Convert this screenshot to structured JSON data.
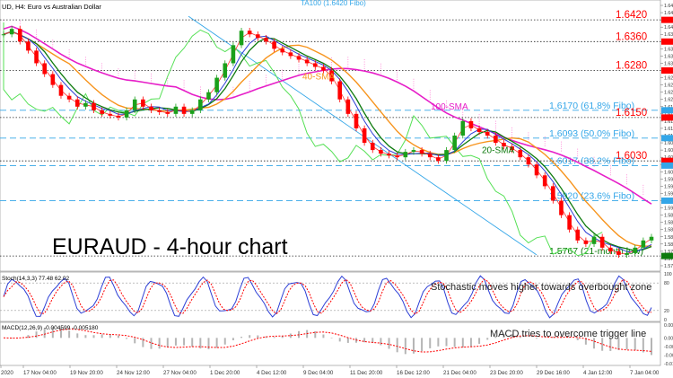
{
  "header": {
    "symbol_text": "UD, H4:  Euro vs Australian Dollar",
    "top_label": "TA100 (1.6420 Fibo)"
  },
  "chart_data": {
    "type": "candlestick",
    "title": "EURAUD - 4-hour chart",
    "x_labels": [
      "2020",
      "17 Nov 04:00",
      "19 Nov 20:00",
      "24 Nov 12:00",
      "27 Nov 04:00",
      "1 Dec 20:00",
      "4 Dec 12:00",
      "9 Dec 04:00",
      "11 Dec 20:00",
      "16 Dec 12:00",
      "21 Dec 04:00",
      "23 Dec 20:00",
      "29 Dec 16:00",
      "4 Jan 12:00",
      "7 Jan 04:00"
    ],
    "price_range": [
      1.573,
      1.647
    ],
    "levels": [
      {
        "price": 1.642,
        "label": "1.6420",
        "color": "#ff0000",
        "style": "dot"
      },
      {
        "price": 1.636,
        "label": "1.6360",
        "color": "#ff0000",
        "style": "dot"
      },
      {
        "price": 1.628,
        "label": "1.6280",
        "color": "#ff0000",
        "style": "dot"
      },
      {
        "price": 1.617,
        "label": "1.6170 (61.8% Fibo)",
        "color": "#33a6e8",
        "style": "dash"
      },
      {
        "price": 1.615,
        "label": "1.6150",
        "color": "#ff0000",
        "style": "dot"
      },
      {
        "price": 1.6093,
        "label": "1.6093 (50.0% Fibo)",
        "color": "#33a6e8",
        "style": "dash"
      },
      {
        "price": 1.603,
        "label": "1.6030",
        "color": "#ff0000",
        "style": "dot"
      },
      {
        "price": 1.6017,
        "label": "1.6017 (38.2% Fibo)",
        "color": "#33a6e8",
        "style": "dash"
      },
      {
        "price": 1.592,
        "label": "1.5920 (23.6% Fibo)",
        "color": "#33a6e8",
        "style": "dash"
      },
      {
        "price": 1.5767,
        "label": "1.5767 (21-month low)",
        "color": "#0d7a0d",
        "style": "dot"
      }
    ],
    "sma_labels": [
      {
        "text": "40-SMA",
        "color": "#f7941d"
      },
      {
        "text": "100-SMA",
        "color": "#e61ec8"
      },
      {
        "text": "20-SMA",
        "color": "#0d7a0d"
      }
    ],
    "closes": [
      1.638,
      1.6395,
      1.636,
      1.6335,
      1.63,
      1.627,
      1.624,
      1.621,
      1.62,
      1.618,
      1.619,
      1.617,
      1.616,
      1.6155,
      1.615,
      1.617,
      1.62,
      1.618,
      1.617,
      1.6165,
      1.616,
      1.618,
      1.616,
      1.617,
      1.62,
      1.622,
      1.626,
      1.63,
      1.635,
      1.639,
      1.638,
      1.637,
      1.636,
      1.634,
      1.633,
      1.632,
      1.631,
      1.63,
      1.629,
      1.628,
      1.625,
      1.62,
      1.616,
      1.612,
      1.608,
      1.606,
      1.605,
      1.6045,
      1.604,
      1.6055,
      1.606,
      1.605,
      1.604,
      1.603,
      1.606,
      1.61,
      1.614,
      1.612,
      1.611,
      1.61,
      1.608,
      1.607,
      1.606,
      1.604,
      1.602,
      1.599,
      1.596,
      1.592,
      1.588,
      1.584,
      1.581,
      1.58,
      1.582,
      1.579,
      1.578,
      1.577,
      1.5775,
      1.579,
      1.581,
      1.582
    ],
    "oscillators": [
      {
        "name": "stochastic",
        "header": "Stoch(14,3,3) 77.48 62.02",
        "annotation": "Stochastic moves higher towards overbought zone",
        "levels": [
          80,
          20
        ],
        "range": [
          0,
          100
        ]
      },
      {
        "name": "macd",
        "header": "MACD(12,26,9) -0.004599 -0.005180",
        "annotation": "MACD tries to overcome trigger line",
        "range": [
          -0.012,
          0.006
        ]
      }
    ]
  },
  "axes": {
    "price_ticks": [
      "1.646",
      "1.644",
      "1.642",
      "1.640",
      "1.638",
      "1.636",
      "1.634",
      "1.632",
      "1.630",
      "1.628",
      "1.626",
      "1.624",
      "1.622",
      "1.620",
      "1.618",
      "1.616",
      "1.614",
      "1.612",
      "1.610",
      "1.608",
      "1.606",
      "1.604",
      "1.602",
      "1.600",
      "1.598",
      "1.596",
      "1.594",
      "1.592",
      "1.590",
      "1.588",
      "1.586",
      "1.584",
      "1.582",
      "1.580",
      "1.578",
      "1.576",
      "1.574"
    ],
    "stoch_ticks": [
      "100",
      "80",
      "20",
      "0"
    ],
    "macd_ticks": [
      "0.0060",
      "0.0000",
      "-0.0040",
      "-0.0080",
      "-0.0119"
    ]
  },
  "colors": {
    "up_candle": "#1aa01a",
    "down_candle": "#ff0000",
    "green_line": "#55e055",
    "cloud": "#ff66cc",
    "fibo": "#33a6e8",
    "stoch_main": "#2d3fd6",
    "stoch_signal": "#ff0000",
    "macd_signal": "#ff0000"
  }
}
